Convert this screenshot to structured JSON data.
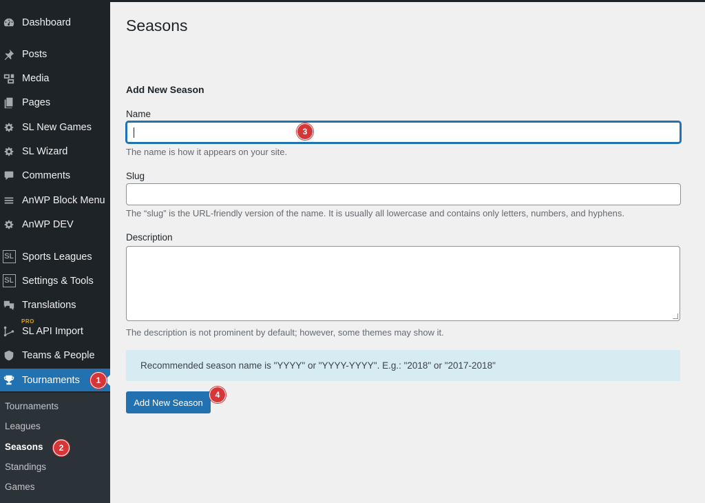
{
  "sidebar": {
    "items": [
      {
        "label": "Dashboard",
        "icon": "dashboard-icon"
      },
      {
        "label": "Posts",
        "icon": "pin-icon"
      },
      {
        "label": "Media",
        "icon": "media-icon"
      },
      {
        "label": "Pages",
        "icon": "pages-icon"
      },
      {
        "label": "SL New Games",
        "icon": "gear-icon"
      },
      {
        "label": "SL Wizard",
        "icon": "gear-icon"
      },
      {
        "label": "Comments",
        "icon": "comment-icon"
      },
      {
        "label": "AnWP Block Menu",
        "icon": "menu-icon"
      },
      {
        "label": "AnWP DEV",
        "icon": "gear-icon"
      },
      {
        "label": "Sports Leagues",
        "icon": "sl-icon",
        "icon_text": "SL"
      },
      {
        "label": "Settings & Tools",
        "icon": "sl-icon",
        "icon_text": "SL"
      },
      {
        "label": "Translations",
        "icon": "translation-icon"
      },
      {
        "label": "SL API Import",
        "icon": "import-icon",
        "badge": "PRO"
      },
      {
        "label": "Teams & People",
        "icon": "shield-icon"
      },
      {
        "label": "Tournaments",
        "icon": "trophy-icon",
        "active": true
      }
    ],
    "submenu": [
      {
        "label": "Tournaments"
      },
      {
        "label": "Leagues"
      },
      {
        "label": "Seasons",
        "current": true
      },
      {
        "label": "Standings"
      },
      {
        "label": "Games"
      }
    ]
  },
  "markers": [
    "1",
    "2",
    "3",
    "4"
  ],
  "page": {
    "title": "Seasons",
    "section_title": "Add New Season",
    "name_label": "Name",
    "name_value": "",
    "name_hint": "The name is how it appears on your site.",
    "slug_label": "Slug",
    "slug_value": "",
    "slug_hint": "The “slug” is the URL-friendly version of the name. It is usually all lowercase and contains only letters, numbers, and hyphens.",
    "description_label": "Description",
    "description_value": "",
    "description_hint": "The description is not prominent by default; however, some themes may show it.",
    "notice": "Recommended season name is \"YYYY\" or \"YYYY-YYYY\". E.g.: \"2018\" or \"2017-2018\"",
    "submit_label": "Add New Season"
  },
  "colors": {
    "sidebar_bg": "#1d2327",
    "submenu_bg": "#2c3338",
    "accent": "#2271b1",
    "marker": "#d63638",
    "notice_bg": "#d7ebf2"
  }
}
